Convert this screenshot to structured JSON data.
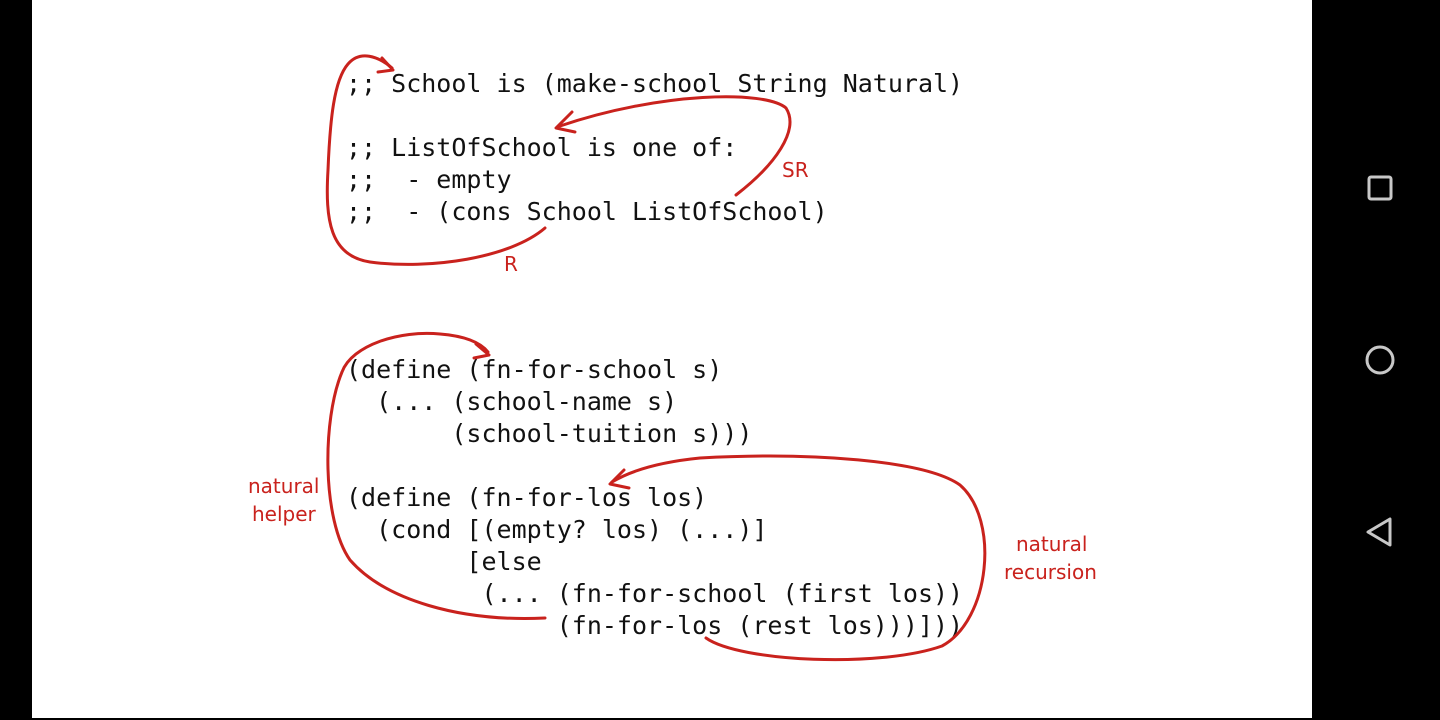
{
  "slide": {
    "data_definition_lines": [
      ";; School is (make-school String Natural)",
      "",
      ";; ListOfSchool is one of:",
      ";;  - empty",
      ";;  - (cons School ListOfSchool)"
    ],
    "template_lines": [
      "(define (fn-for-school s)",
      "  (... (school-name s)",
      "       (school-tuition s)))",
      "",
      "(define (fn-for-los los)",
      "  (cond [(empty? los) (...)]",
      "        [else",
      "         (... (fn-for-school (first los))",
      "              (fn-for-los (rest los)))]))"
    ],
    "annotations": {
      "sr": "SR",
      "r": "R",
      "natural_helper_line1": "natural",
      "natural_helper_line2": "helper",
      "natural_recursion_line1": "natural",
      "natural_recursion_line2": "recursion"
    },
    "annotation_color": "#c9221d"
  },
  "navbar": {
    "buttons": [
      {
        "name": "recents-button",
        "icon": "square-icon"
      },
      {
        "name": "home-button",
        "icon": "circle-icon"
      },
      {
        "name": "back-button",
        "icon": "triangle-back-icon"
      }
    ]
  }
}
